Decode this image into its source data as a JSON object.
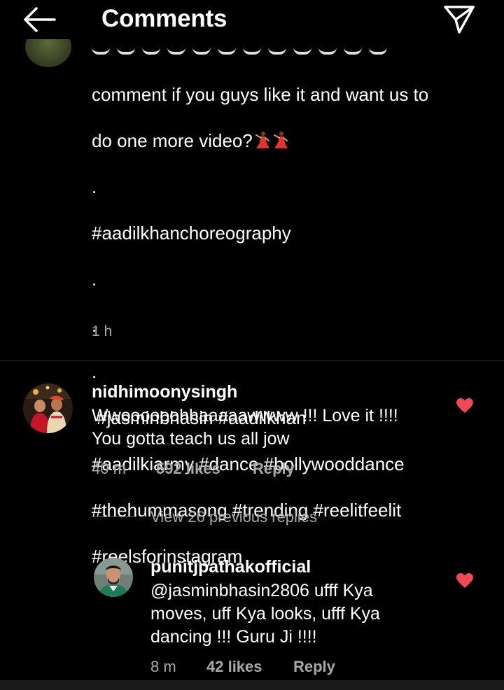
{
  "header": {
    "title": "Comments",
    "back_icon": "arrow-left-icon",
    "send_icon": "paper-plane-icon"
  },
  "caption": {
    "lines": [
      "comment if you guys like it and want us to",
      "do one more video?",
      ".",
      "#aadilkhanchoreography",
      ".",
      ".",
      ".",
      " #jasminbhasin #aadilkhan",
      "#aadilkiarmy #dance #bollywooddance",
      "#thehummasong #trending #reelitfeelit",
      "#reelsforinstagram"
    ],
    "emoji": "dancer-emoji",
    "time": "1 h"
  },
  "comments": [
    {
      "username": "nidhimoonysingh",
      "line1": "Wwoooooohhaaaaawwww !!! Love it !!!!",
      "line2": "You gotta teach us all jow",
      "time": "40 m",
      "likes": "592 likes",
      "reply": "Reply",
      "liked": true
    }
  ],
  "replies_toggle": "View 26 previous replies",
  "reply": {
    "username": "punitjpathakofficial",
    "line1": "@jasminbhasin2806 ufff Kya",
    "line2": "moves, uff Kya looks, ufff Kya",
    "line3": "dancing !!! Guru Ji !!!!",
    "time": "8 m",
    "likes": "42 likes",
    "reply": "Reply",
    "liked": true
  },
  "colors": {
    "background": "#000000",
    "secondary_text": "#a8a8a8",
    "heart": "#ed4956",
    "divider": "#262626"
  }
}
